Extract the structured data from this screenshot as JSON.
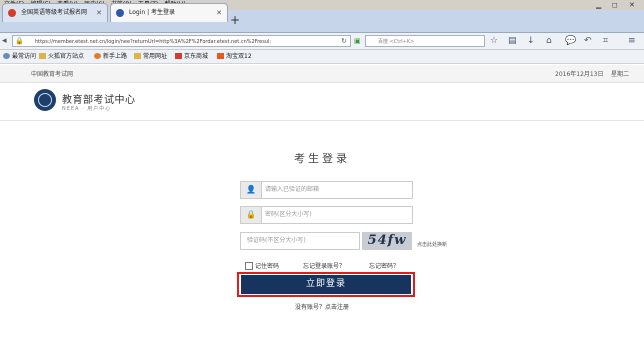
{
  "menu": [
    "文件(F)",
    "编辑(E)",
    "查看(V)",
    "历史(S)",
    "书签(B)",
    "工具(T)",
    "帮助(H)"
  ],
  "tabs": [
    {
      "title": "全国英语等级考试报名网",
      "active": false,
      "favicon_color": "#d73b2a"
    },
    {
      "title": "Login | 考生登录",
      "active": true,
      "favicon_color": "#2b5aa8"
    }
  ],
  "toolbar": {
    "url": "https://member.etest.net.cn/login/nee?returnUrl=http%3A%2F%2Fordar.etest.net.cn%2Fresul:",
    "search_placeholder": "百度 <Ctrl+K>"
  },
  "bookmarks": [
    "最常访问",
    "火狐官方站点",
    "新手上路",
    "常用网址",
    "京东商城",
    "淘宝双12"
  ],
  "header": {
    "site_name": "中国教育考试网",
    "date": "2016年12月13日",
    "weekday": "星期二",
    "logo_title": "教育部考试中心",
    "logo_subtitle": "NEEA · 用户中心"
  },
  "login": {
    "title": "考生登录",
    "username_placeholder": "请输入已验证的邮箱",
    "password_placeholder": "密码(区分大小写)",
    "captcha_placeholder": "验证码(不区分大小写)",
    "captcha_text": "54fw",
    "captcha_refresh": "点击此处换新",
    "remember_label": "记住密码",
    "forgot_account": "忘记登录账号？",
    "forgot_password": "忘记密码？",
    "submit_label": "立即登录",
    "register_text": "没有账号？点击注册"
  },
  "colors": {
    "accent": "#17345f",
    "highlight": "#e21b1b"
  }
}
